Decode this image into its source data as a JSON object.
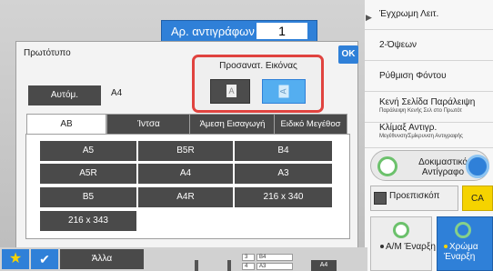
{
  "copies": {
    "label": "Αρ. αντιγράφων",
    "value": "1"
  },
  "dialog": {
    "title": "Πρωτότυπο",
    "ok_label": "OK",
    "orientation": {
      "label": "Προσανατ. Εικόνας",
      "portrait_glyph": "A",
      "landscape_glyph": "A",
      "selected": "landscape"
    },
    "auto_label": "Αυτόμ.",
    "size_label": "A4",
    "tabs": [
      {
        "label": "AB",
        "active": true
      },
      {
        "label": "Ίντσα",
        "active": false
      },
      {
        "label": "Άμεση Εισαγωγή",
        "active": false
      },
      {
        "label": "Ειδικό Μεγέθοσ",
        "active": false
      }
    ],
    "paper_sizes": [
      "A5",
      "B5R",
      "B4",
      "A5R",
      "A4",
      "A3",
      "B5",
      "A4R",
      "216 x 340",
      "216 x 343"
    ]
  },
  "right_panel": {
    "items": [
      {
        "title": "Έγχρωμη Λειτ.",
        "sub": ""
      },
      {
        "title": "2-Όψεων",
        "sub": ""
      },
      {
        "title": "Ρύθμιση Φόντου",
        "sub": ""
      },
      {
        "title": "Κενή Σελίδα Παράλειψη",
        "sub": "Παράλειψη Κενής Σελ στο Πρωτότ"
      },
      {
        "title": "Κλίμαξ Αντιγρ.",
        "sub": "Μεγέθυνση/Σμίκρυνση Αντιγραφής"
      }
    ],
    "test_copy_label": "Δοκιμαστικό Αντίγραφο",
    "preview_label": "Προεπισκόπ",
    "ca_label": "CA",
    "bw_start_label": "Α/Μ Έναρξη",
    "color_start_label": "Χρώμα Έναρξη"
  },
  "bottom": {
    "other_label": "Άλλα",
    "trays": [
      "3",
      "B4",
      "4",
      "A3"
    ],
    "output_label": "A4"
  },
  "colors": {
    "accent": "#2f80d8",
    "highlight": "#e0433f",
    "button_dark": "#4a4a4a"
  }
}
